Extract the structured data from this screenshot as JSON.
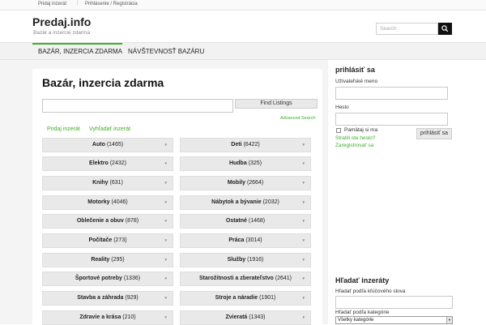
{
  "topbar": {
    "post_ad": "Pridaj inzerát",
    "separator": "|",
    "login_register": "Prihlásenie / Registrácia"
  },
  "header": {
    "site_title": "Predaj.info",
    "tagline": "Bazár a inzercie zdarma",
    "search_placeholder": "Search"
  },
  "nav": {
    "items": [
      {
        "label": "BAZÁR, INZERCIA ZDARMA"
      },
      {
        "label": "NÁVŠTEVNOSŤ BAZÁRU"
      }
    ]
  },
  "main": {
    "title": "Bazár, inzercia zdarma",
    "find_button": "Find Listings",
    "advanced_search": "Advanced Search",
    "tabs": [
      {
        "label": "Pridaj inzerát"
      },
      {
        "label": "Vyhľadať inzerát"
      }
    ],
    "categories": [
      {
        "name": "Auto",
        "count": "(1465)"
      },
      {
        "name": "Deti",
        "count": "(6422)"
      },
      {
        "name": "Elektro",
        "count": "(2432)"
      },
      {
        "name": "Hudba",
        "count": "(325)"
      },
      {
        "name": "Knihy",
        "count": "(631)"
      },
      {
        "name": "Mobily",
        "count": "(2664)"
      },
      {
        "name": "Motorky",
        "count": "(4046)"
      },
      {
        "name": "Nábytok a bývanie",
        "count": "(2032)"
      },
      {
        "name": "Oblečenie a obuv",
        "count": "(878)"
      },
      {
        "name": "Ostatné",
        "count": "(1468)"
      },
      {
        "name": "Počítače",
        "count": "(273)"
      },
      {
        "name": "Práca",
        "count": "(3014)"
      },
      {
        "name": "Reality",
        "count": "(295)"
      },
      {
        "name": "Služby",
        "count": "(1916)"
      },
      {
        "name": "Športové potreby",
        "count": "(1336)"
      },
      {
        "name": "Starožitnosti a zberateľstvo",
        "count": "(2641)"
      },
      {
        "name": "Stavba a záhrada",
        "count": "(929)"
      },
      {
        "name": "Stroje a náradie",
        "count": "(1901)"
      },
      {
        "name": "Zdravie a krása",
        "count": "(210)"
      },
      {
        "name": "Zvieratá",
        "count": "(1343)"
      }
    ]
  },
  "sidebar": {
    "login": {
      "title": "prihlásiť sa",
      "username_label": "Užívateľské meno",
      "password_label": "Heslo",
      "remember_label": "Pamätaj si ma",
      "login_button": "prihlásiť sa",
      "forgot_password": "Stratili ste heslo?",
      "register": "Zaregistrovať sa"
    },
    "search": {
      "title": "Hľadať inzeráty",
      "keyword_label": "Hľadať podľa kľúčového slova",
      "category_label": "Hľadať podľa kategórie",
      "category_selected": "Všetky kategórie"
    }
  },
  "colors": {
    "accent": "#3fae29",
    "nav_bg": "#f2f2f2",
    "category_bg": "#e9e9e9"
  }
}
